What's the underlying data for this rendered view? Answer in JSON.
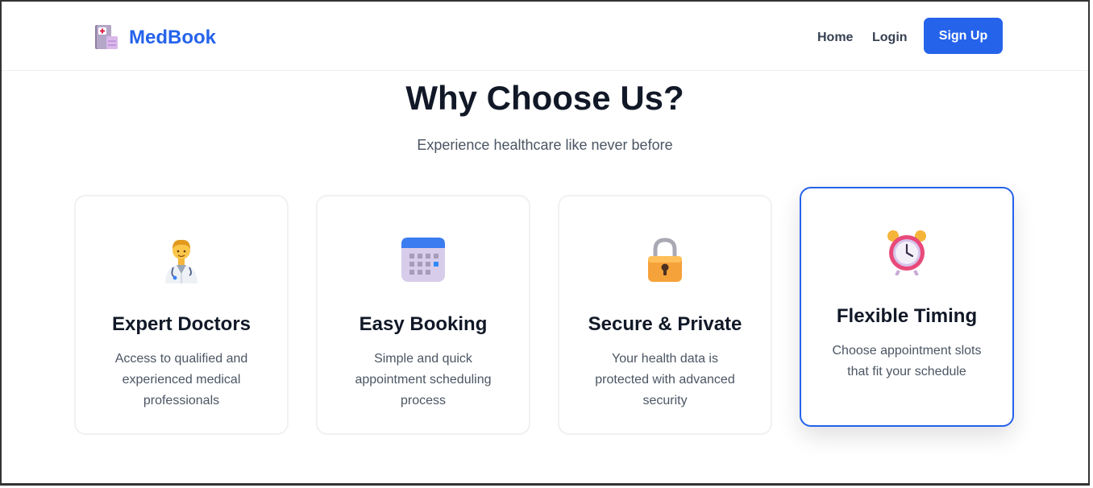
{
  "colors": {
    "accent": "#2563eb",
    "heading": "#111827",
    "body": "#4b5563",
    "border": "#f0f1f4"
  },
  "navbar": {
    "brand": "MedBook",
    "brand_icon": "medical-notebook-icon",
    "links": [
      {
        "label": "Home"
      },
      {
        "label": "Login"
      }
    ],
    "signup_label": "Sign Up"
  },
  "hero": {
    "title": "Why Choose Us?",
    "subtitle": "Experience healthcare like never before"
  },
  "features": [
    {
      "icon": "doctor-icon",
      "title": "Expert Doctors",
      "description": "Access to qualified and experienced medical professionals"
    },
    {
      "icon": "calendar-icon",
      "title": "Easy Booking",
      "description": "Simple and quick appointment scheduling process"
    },
    {
      "icon": "lock-icon",
      "title": "Secure & Private",
      "description": "Your health data is protected with advanced security"
    },
    {
      "icon": "alarm-clock-icon",
      "title": "Flexible Timing",
      "description": "Choose appointment slots that fit your schedule"
    }
  ]
}
